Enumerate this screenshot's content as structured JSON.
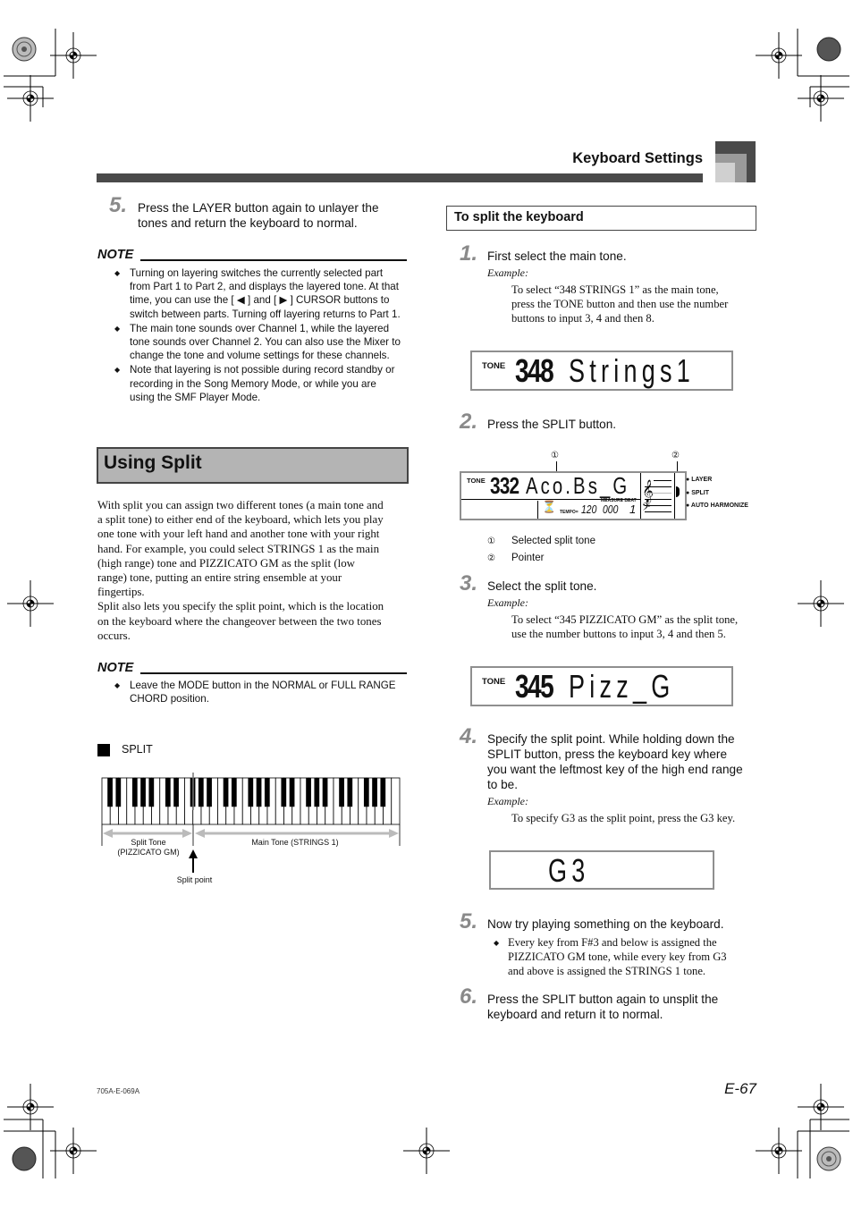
{
  "header": {
    "section_title": "Keyboard Settings"
  },
  "left_column": {
    "step5": {
      "number": "5.",
      "text_line1": "Press the LAYER button again to unlayer the",
      "text_line2": "tones and return the keyboard to normal."
    },
    "note1": {
      "heading": "NOTE",
      "bullets": [
        {
          "lines": [
            "Turning on layering switches the currently selected part",
            "from Part 1 to Part 2, and displays the layered tone. At that",
            "time, you can use the [ ◀ ] and [ ▶ ] CURSOR buttons to",
            "switch between parts. Turning off layering returns to Part 1."
          ]
        },
        {
          "lines": [
            "The main tone sounds over Channel 1, while the layered",
            "tone sounds over Channel 2. You can also use the Mixer to",
            "change the tone and volume settings for these channels."
          ]
        },
        {
          "lines": [
            "Note that layering is not possible during record standby or",
            "recording in the Song Memory Mode, or while you are",
            "using the SMF Player Mode."
          ]
        }
      ]
    },
    "section": {
      "title": "Using Split",
      "paragraph_lines": [
        "With split you can assign two different tones (a main tone and",
        "a split tone) to either end of the keyboard, which lets you play",
        "one tone with your left hand and another tone with your right",
        "hand. For example, you could select STRINGS 1 as the main",
        "(high range) tone and PIZZICATO GM as the split (low",
        "range) tone, putting an entire string ensemble at your",
        "fingertips.",
        "Split also lets you specify the split point, which is the location",
        "on the keyboard where the changeover between the two tones",
        "occurs."
      ]
    },
    "note2": {
      "heading": "NOTE",
      "bullets": [
        {
          "lines": [
            "Leave the MODE button in the NORMAL or FULL RANGE",
            "CHORD position."
          ]
        }
      ]
    },
    "button_label": "SPLIT",
    "keyboard_diagram": {
      "split_tone_label_1": "Split Tone",
      "split_tone_label_2": "(PIZZICATO GM)",
      "main_tone_label": "Main Tone (STRINGS 1)",
      "split_point_label": "Split point"
    }
  },
  "right_column": {
    "subsection_title": "To split the keyboard",
    "steps": {
      "s1": {
        "number": "1.",
        "text": "First select the main tone.",
        "example_label": "Example:",
        "example_lines": [
          "To select “348 STRINGS 1” as the main tone,",
          "press the TONE button and then use the number",
          "buttons to input 3, 4 and then 8."
        ]
      },
      "s2": {
        "number": "2.",
        "text": "Press the SPLIT button."
      },
      "s3": {
        "number": "3.",
        "text": "Select the split tone.",
        "example_label": "Example:",
        "example_lines": [
          "To select “345 PIZZICATO GM” as the split tone,",
          "use the number buttons to input 3, 4 and then 5."
        ]
      },
      "s4": {
        "number": "4.",
        "text_lines": [
          "Specify the split point. While holding down the",
          "SPLIT button, press the keyboard key where",
          "you want the leftmost key of the high end range",
          "to be."
        ],
        "example_label": "Example:",
        "example_lines": [
          "To specify G3 as the split point, press the G3 key."
        ]
      },
      "s5": {
        "number": "5.",
        "text": "Now try playing something on the keyboard.",
        "bullet_lines": [
          "Every key from F#3 and below is assigned the",
          "PIZZICATO GM tone, while every key from G3",
          "and above is assigned the STRINGS 1 tone."
        ]
      },
      "s6": {
        "number": "6.",
        "text_lines": [
          "Press the SPLIT button again to unsplit the",
          "keyboard and return it to normal."
        ]
      }
    },
    "lcd1": {
      "tone_label": "TONE",
      "number": "348",
      "name": "Strings1"
    },
    "lcd2": {
      "tone_label": "TONE",
      "number": "332",
      "name": "Aco.Bs_G",
      "measure_beat_label": "MEASURE BEAT",
      "tempo_label": "TEMPO=",
      "tempo_value": "120",
      "measure_value": "000",
      "beat_value": "1",
      "indicators": [
        "LAYER",
        "SPLIT",
        "AUTO HARMONIZE"
      ],
      "callout1": "①",
      "callout2": "②"
    },
    "legend": [
      {
        "marker": "①",
        "text": "Selected split tone"
      },
      {
        "marker": "②",
        "text": "Pointer"
      }
    ],
    "lcd3": {
      "tone_label": "TONE",
      "number": "345",
      "name": "Pizz_G"
    },
    "lcd4": {
      "text": "G3"
    }
  },
  "footer": {
    "code": "705A-E-069A",
    "page": "E-67"
  }
}
